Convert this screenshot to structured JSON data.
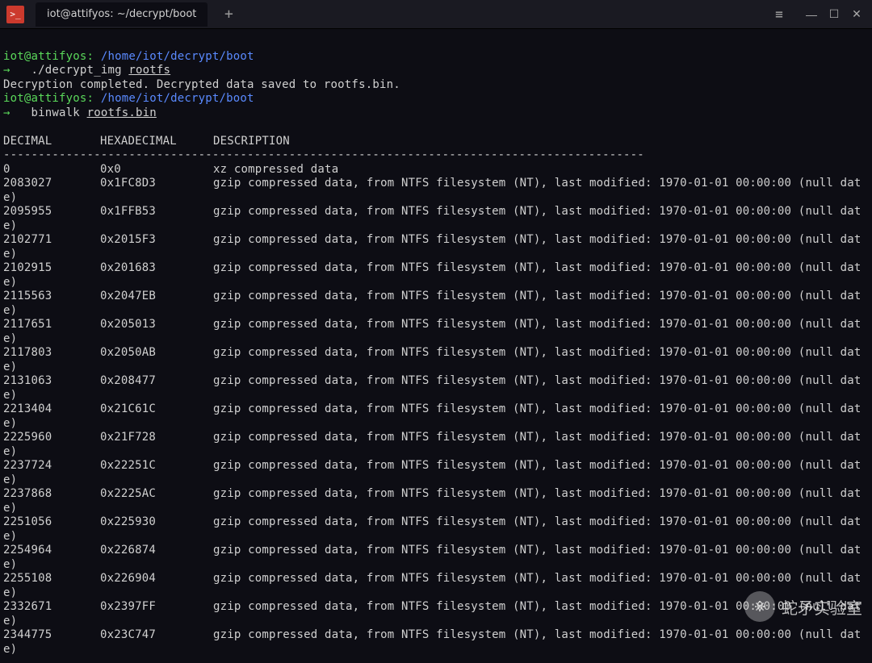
{
  "window": {
    "tab_title": "iot@attifyos: ~/decrypt/boot",
    "new_tab_glyph": "+",
    "menu_glyph": "≡",
    "min_glyph": "—",
    "max_glyph": "☐",
    "close_glyph": "✕"
  },
  "prompt1": {
    "user_host": "iot@attifyos:",
    "path": "/home/iot/decrypt/boot",
    "arrow": "→",
    "cmd_prefix": "./decrypt_img ",
    "cmd_arg": "rootfs"
  },
  "output1": "Decryption completed. Decrypted data saved to rootfs.bin.",
  "prompt2": {
    "user_host": "iot@attifyos:",
    "path": "/home/iot/decrypt/boot",
    "arrow": "→",
    "cmd_prefix": "binwalk ",
    "cmd_arg": "rootfs.bin"
  },
  "table": {
    "header_decimal": "DECIMAL",
    "header_hex": "HEXADECIMAL",
    "header_desc": "DESCRIPTION",
    "dashes": "--------------------------------------------------------------------------------------------",
    "rows": [
      {
        "dec": "0",
        "hex": "0x0",
        "desc": "xz compressed data",
        "wrap": false
      },
      {
        "dec": "2083027",
        "hex": "0x1FC8D3",
        "desc": "gzip compressed data, from NTFS filesystem (NT), last modified: 1970-01-01 00:00:00 (null dat",
        "wrap": true
      },
      {
        "dec": "2095955",
        "hex": "0x1FFB53",
        "desc": "gzip compressed data, from NTFS filesystem (NT), last modified: 1970-01-01 00:00:00 (null dat",
        "wrap": true
      },
      {
        "dec": "2102771",
        "hex": "0x2015F3",
        "desc": "gzip compressed data, from NTFS filesystem (NT), last modified: 1970-01-01 00:00:00 (null dat",
        "wrap": true
      },
      {
        "dec": "2102915",
        "hex": "0x201683",
        "desc": "gzip compressed data, from NTFS filesystem (NT), last modified: 1970-01-01 00:00:00 (null dat",
        "wrap": true
      },
      {
        "dec": "2115563",
        "hex": "0x2047EB",
        "desc": "gzip compressed data, from NTFS filesystem (NT), last modified: 1970-01-01 00:00:00 (null dat",
        "wrap": true
      },
      {
        "dec": "2117651",
        "hex": "0x205013",
        "desc": "gzip compressed data, from NTFS filesystem (NT), last modified: 1970-01-01 00:00:00 (null dat",
        "wrap": true
      },
      {
        "dec": "2117803",
        "hex": "0x2050AB",
        "desc": "gzip compressed data, from NTFS filesystem (NT), last modified: 1970-01-01 00:00:00 (null dat",
        "wrap": true
      },
      {
        "dec": "2131063",
        "hex": "0x208477",
        "desc": "gzip compressed data, from NTFS filesystem (NT), last modified: 1970-01-01 00:00:00 (null dat",
        "wrap": true
      },
      {
        "dec": "2213404",
        "hex": "0x21C61C",
        "desc": "gzip compressed data, from NTFS filesystem (NT), last modified: 1970-01-01 00:00:00 (null dat",
        "wrap": true
      },
      {
        "dec": "2225960",
        "hex": "0x21F728",
        "desc": "gzip compressed data, from NTFS filesystem (NT), last modified: 1970-01-01 00:00:00 (null dat",
        "wrap": true
      },
      {
        "dec": "2237724",
        "hex": "0x22251C",
        "desc": "gzip compressed data, from NTFS filesystem (NT), last modified: 1970-01-01 00:00:00 (null dat",
        "wrap": true
      },
      {
        "dec": "2237868",
        "hex": "0x2225AC",
        "desc": "gzip compressed data, from NTFS filesystem (NT), last modified: 1970-01-01 00:00:00 (null dat",
        "wrap": true
      },
      {
        "dec": "2251056",
        "hex": "0x225930",
        "desc": "gzip compressed data, from NTFS filesystem (NT), last modified: 1970-01-01 00:00:00 (null dat",
        "wrap": true
      },
      {
        "dec": "2254964",
        "hex": "0x226874",
        "desc": "gzip compressed data, from NTFS filesystem (NT), last modified: 1970-01-01 00:00:00 (null dat",
        "wrap": true
      },
      {
        "dec": "2255108",
        "hex": "0x226904",
        "desc": "gzip compressed data, from NTFS filesystem (NT), last modified: 1970-01-01 00:00:00 (null dat",
        "wrap": true
      },
      {
        "dec": "2332671",
        "hex": "0x2397FF",
        "desc": "gzip compressed data, from NTFS filesystem (NT), last modified: 1970-01-01 00:00:00 (null dat",
        "wrap": true
      },
      {
        "dec": "2344775",
        "hex": "0x23C747",
        "desc": "gzip compressed data, from NTFS filesystem (NT), last modified: 1970-01-01 00:00:00 (null dat",
        "wrap": true
      }
    ],
    "wrap_text": "e)"
  },
  "watermark": {
    "text": "蛇矛实验室",
    "icon_glyph": "※"
  }
}
